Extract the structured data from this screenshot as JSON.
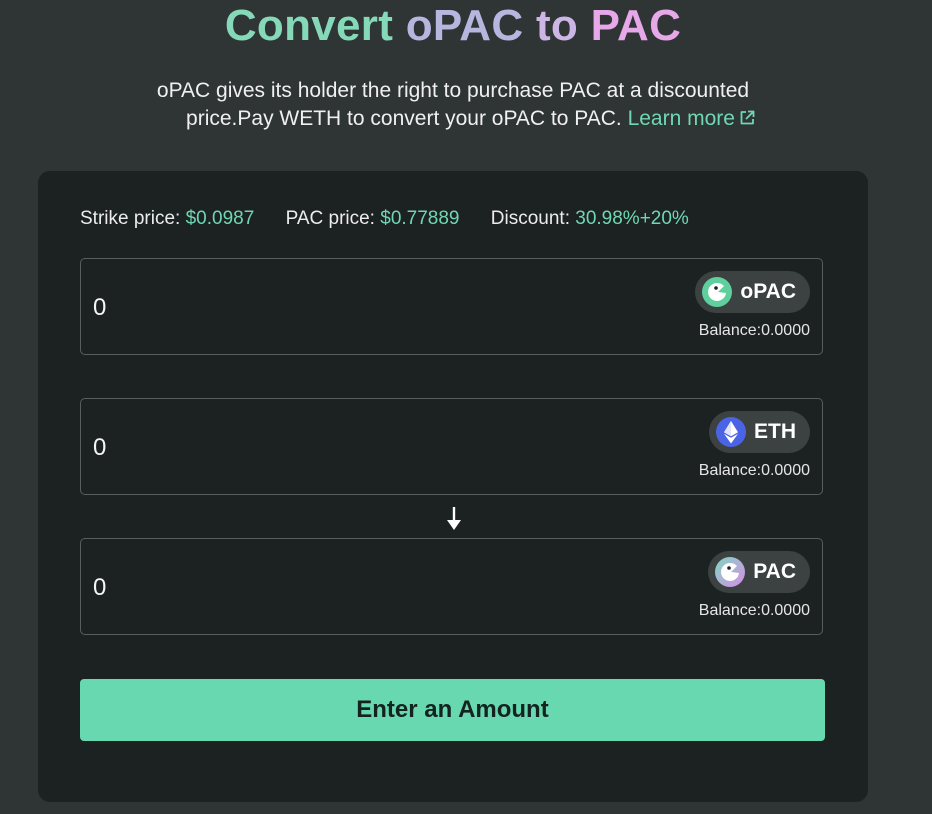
{
  "header": {
    "title_parts": [
      "Convert",
      "oPAC",
      "to",
      "PAC"
    ],
    "description_line1": "oPAC gives its holder the right to purchase PAC at a discounted",
    "description_line2": "price.Pay WETH to convert your oPAC to PAC.",
    "learn_more_label": "Learn more",
    "learn_more_icon": "external-link-icon"
  },
  "stats": {
    "strike_label": "Strike price:",
    "strike_value": "$0.0987",
    "pac_label": "PAC price:",
    "pac_value": "$0.77889",
    "discount_label": "Discount:",
    "discount_value": "30.98%+20%"
  },
  "fields": [
    {
      "value": "0",
      "token": "oPAC",
      "icon": "opac-token-icon",
      "balance": "Balance:0.0000"
    },
    {
      "value": "0",
      "token": "ETH",
      "icon": "eth-token-icon",
      "balance": "Balance:0.0000"
    },
    {
      "value": "0",
      "token": "PAC",
      "icon": "pac-token-icon",
      "balance": "Balance:0.0000"
    }
  ],
  "divider_icon": "arrow-down-icon",
  "cta_label": "Enter an Amount",
  "colors": {
    "background": "#2f3434",
    "card": "#1c2121",
    "accent_green": "#67d8b0",
    "highlight_text": "#6fd7b1",
    "pill": "#3c4141",
    "eth_blue": "#4b64e6"
  }
}
